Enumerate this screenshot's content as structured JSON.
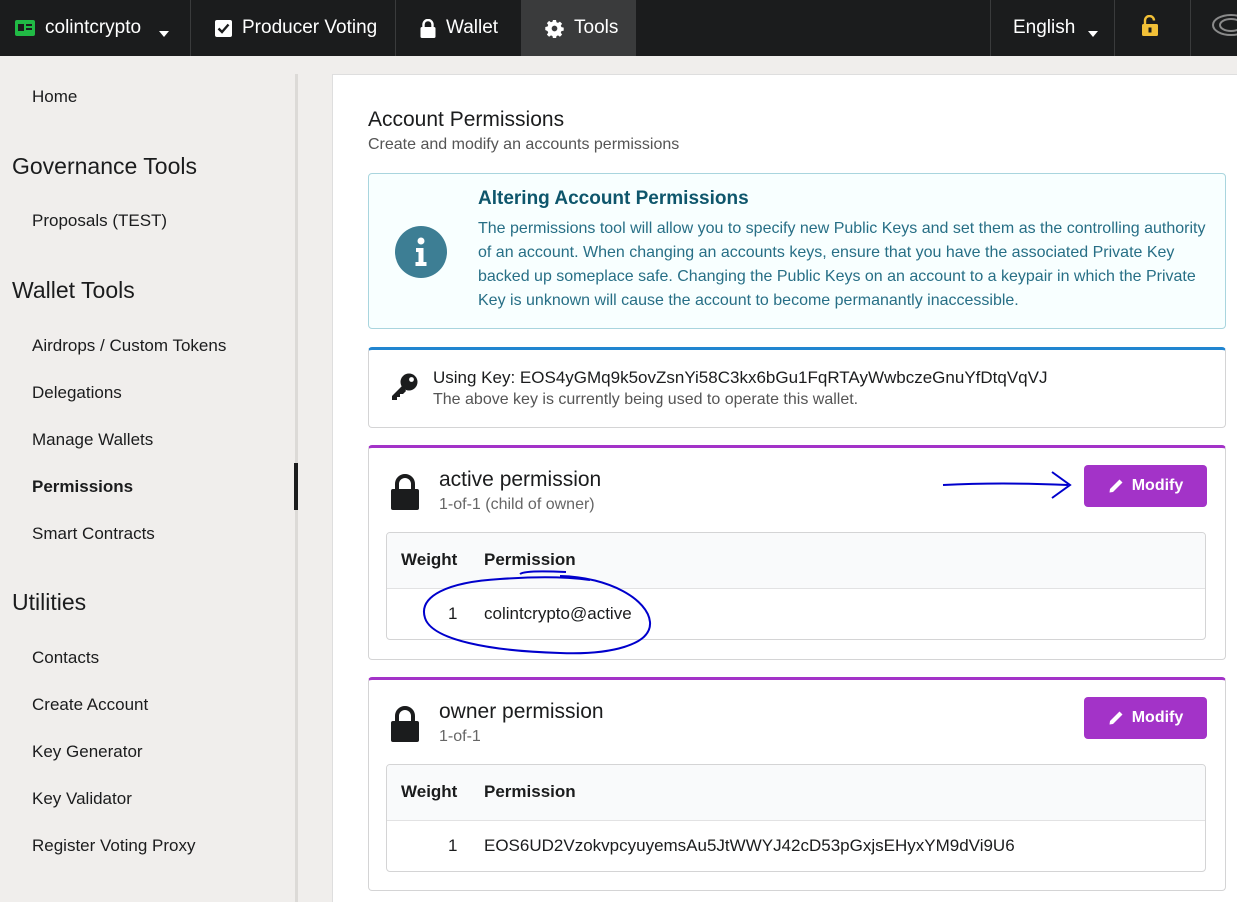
{
  "topbar": {
    "account": "colintcrypto",
    "producer_voting": "Producer Voting",
    "wallet": "Wallet",
    "tools": "Tools",
    "language": "English"
  },
  "sidebar": {
    "home": "Home",
    "governance_heading": "Governance Tools",
    "proposals": "Proposals (TEST)",
    "wallet_heading": "Wallet Tools",
    "airdrops": "Airdrops / Custom Tokens",
    "delegations": "Delegations",
    "manage_wallets": "Manage Wallets",
    "permissions": "Permissions",
    "smart_contracts": "Smart Contracts",
    "utilities_heading": "Utilities",
    "contacts": "Contacts",
    "create_account": "Create Account",
    "key_generator": "Key Generator",
    "key_validator": "Key Validator",
    "register_proxy": "Register Voting Proxy"
  },
  "main": {
    "title": "Account Permissions",
    "subtitle": "Create and modify an accounts permissions",
    "info": {
      "title": "Altering Account Permissions",
      "body": "The permissions tool will allow you to specify new Public Keys and set them as the controlling authority of an account. When changing an accounts keys, ensure that you have the associated Private Key backed up someplace safe. Changing the Public Keys on an account to a keypair in which the Private Key is unknown will cause the account to become permanantly inaccessible."
    },
    "key": {
      "title": "Using Key: EOS4yGMq9k5ovZsnYi58C3kx6bGu1FqRTAyWwbczeGnuYfDtqVqVJ",
      "subtitle": "The above key is currently being used to operate this wallet."
    },
    "permissions": [
      {
        "title": "active permission",
        "subtitle": "1-of-1 (child of owner)",
        "modify_label": "Modify",
        "col_weight": "Weight",
        "col_permission": "Permission",
        "rows": [
          {
            "weight": "1",
            "permission": "colintcrypto@active"
          }
        ]
      },
      {
        "title": "owner permission",
        "subtitle": "1-of-1",
        "modify_label": "Modify",
        "col_weight": "Weight",
        "col_permission": "Permission",
        "rows": [
          {
            "weight": "1",
            "permission": "EOS6UD2VzokvpcyuyemsAu5JtWWYJ42cD53pGxjsEHyxYM9dVi9U6"
          }
        ]
      }
    ]
  },
  "colors": {
    "topbar": "#1b1c1d",
    "modify_button": "#a333c8",
    "info_border": "#a9d5de",
    "annotation": "#0000cc"
  }
}
